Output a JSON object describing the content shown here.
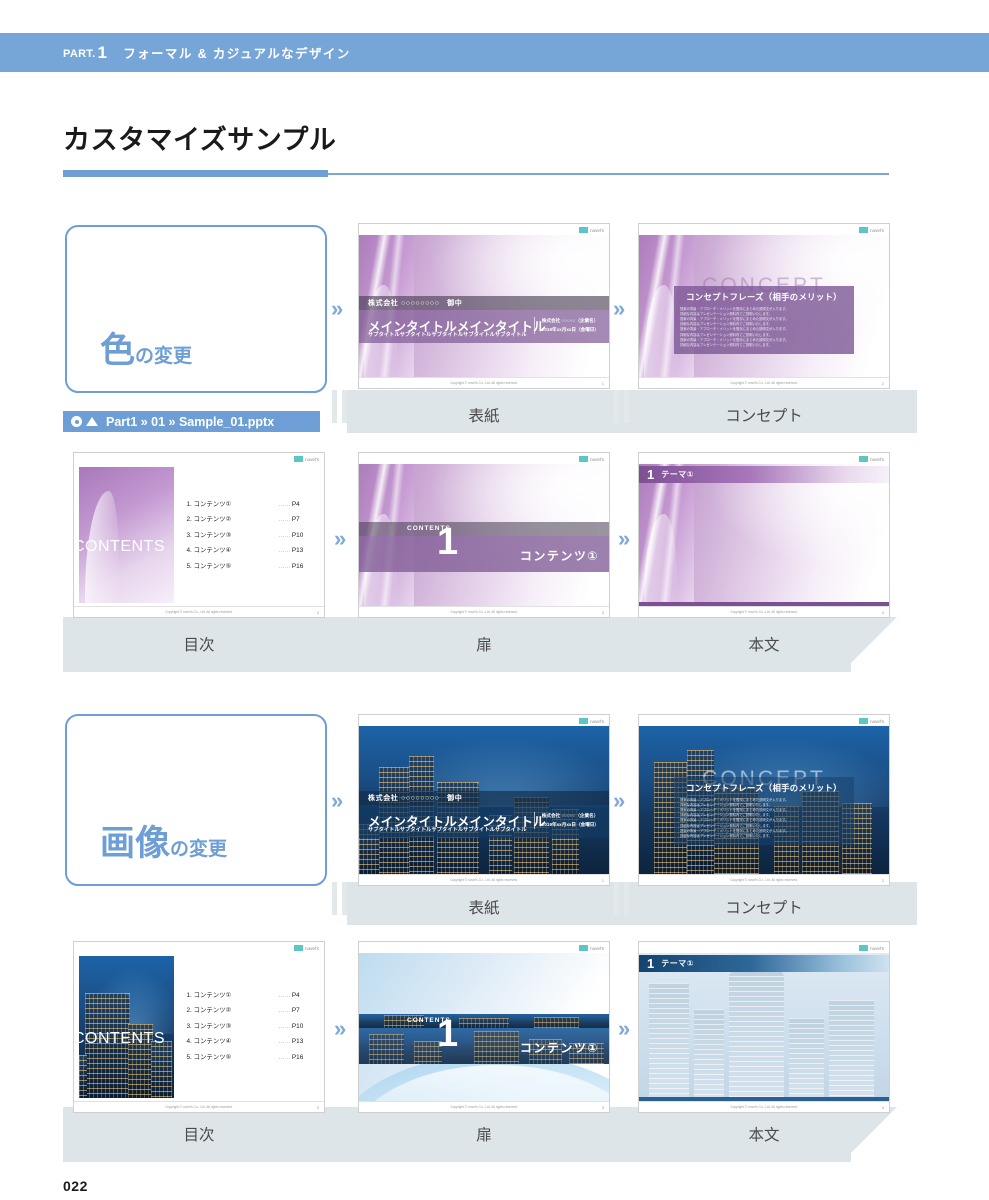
{
  "header": {
    "part_label": "PART.",
    "part_number": "1",
    "part_title": "フォーマル & カジュアルなデザイン"
  },
  "page_title": "カスタマイズサンプル",
  "folio": "022",
  "logo": {
    "text": "novel's"
  },
  "slide_footer": {
    "copyright": "Copyright © novel's Co., Ltd. All rights reserved."
  },
  "sections": [
    {
      "id": "color",
      "callout": {
        "big": "色",
        "small": "の変更"
      },
      "path": {
        "text": "Part1 » 01 » Sample_01.pptx"
      },
      "captions": {
        "cover": "表紙",
        "concept": "コンセプト",
        "contents": "目次",
        "divider": "扉",
        "body": "本文"
      }
    },
    {
      "id": "image",
      "callout": {
        "big": "画像",
        "small": "の変更"
      },
      "captions": {
        "cover": "表紙",
        "concept": "コンセプト",
        "contents": "目次",
        "divider": "扉",
        "body": "本文"
      }
    }
  ],
  "slides": {
    "cover": {
      "addressee": "株式会社 ○○○○○○○○　御中",
      "title": "メインタイトルメインタイトル",
      "subtitle": "サブタイトルサブタイトルサブタイトルサブタイトルサブタイトル",
      "meta_company": "株式会社 ○○○○○（企業名）",
      "meta_date": "2019年xx月xx日（金曜日）",
      "page_number": "1"
    },
    "concept": {
      "watermark": "CONCEPT",
      "headline": "コンセプトフレーズ（相手のメリット）",
      "body_lines": [
        "提案の背景・アプローチ・メリットを簡潔にまとめた説明文が入ります。",
        "詳細な内容はプレゼンテーション資料内でご説明いたします。",
        "提案の背景・アプローチ・メリットを簡潔にまとめた説明文が入ります。",
        "詳細な内容はプレゼンテーション資料内でご説明いたします。",
        "提案の背景・アプローチ・メリットを簡潔にまとめた説明文が入ります。",
        "詳細な内容はプレゼンテーション資料内でご説明いたします。",
        "提案の背景・アプローチ・メリットを簡潔にまとめた説明文が入ります。",
        "詳細な内容はプレゼンテーション資料内でご説明いたします。"
      ],
      "page_number": "2"
    },
    "contents": {
      "watermark": "CONTENTS",
      "items": [
        {
          "label": "1. コンテンツ①",
          "dots": "……",
          "page": "P4"
        },
        {
          "label": "2. コンテンツ②",
          "dots": "……",
          "page": "P7"
        },
        {
          "label": "3. コンテンツ③",
          "dots": "……",
          "page": "P10"
        },
        {
          "label": "4. コンテンツ④",
          "dots": "……",
          "page": "P13"
        },
        {
          "label": "5. コンテンツ⑤",
          "dots": "……",
          "page": "P16"
        }
      ],
      "page_number": "2"
    },
    "divider": {
      "label": "CONTENTS",
      "number": "1",
      "title": "コンテンツ①",
      "page_number": "3"
    },
    "body": {
      "number": "1",
      "title": "テーマ①",
      "page_number": "4"
    }
  },
  "arrow": {
    "glyph": "»"
  },
  "colors": {
    "header_band": "#76a5d8",
    "accent_blue": "#6d9fd6",
    "flow_band": "#dde5e8",
    "logo_teal": "#5cc6c6",
    "purple": "#805c96",
    "navy": "#143a62"
  }
}
